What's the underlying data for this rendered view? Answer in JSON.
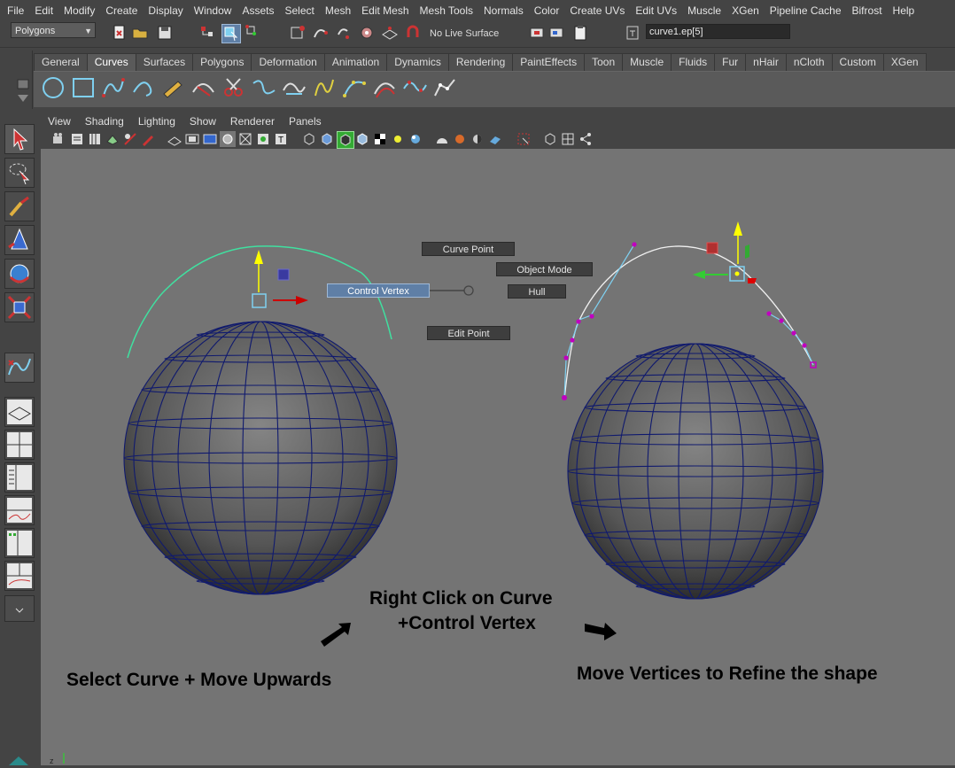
{
  "menubar": [
    "File",
    "Edit",
    "Modify",
    "Create",
    "Display",
    "Window",
    "Assets",
    "Select",
    "Mesh",
    "Edit Mesh",
    "Mesh Tools",
    "Normals",
    "Color",
    "Create UVs",
    "Edit UVs",
    "Muscle",
    "XGen",
    "Pipeline Cache",
    "Bifrost",
    "Help"
  ],
  "status": {
    "mode": "Polygons",
    "live_surface": "No Live Surface",
    "selection_field": "curve1.ep[5]"
  },
  "shelf": {
    "tabs": [
      "General",
      "Curves",
      "Surfaces",
      "Polygons",
      "Deformation",
      "Animation",
      "Dynamics",
      "Rendering",
      "PaintEffects",
      "Toon",
      "Muscle",
      "Fluids",
      "Fur",
      "nHair",
      "nCloth",
      "Custom",
      "XGen"
    ],
    "active_tab": "Curves"
  },
  "panel_menu": [
    "View",
    "Shading",
    "Lighting",
    "Show",
    "Renderer",
    "Panels"
  ],
  "marking_menu": {
    "curve_point": "Curve Point",
    "object_mode": "Object Mode",
    "control_vertex": "Control Vertex",
    "hull": "Hull",
    "edit_point": "Edit Point"
  },
  "captions": {
    "step1": "Select Curve + Move Upwards",
    "step2_line1": "Right Click on Curve",
    "step2_line2": "+Control Vertex",
    "step3": "Move Vertices to Refine the shape"
  },
  "colors": {
    "viewport_bg": "#747474",
    "ui_bg": "#444444",
    "curve_selected": "#40e0a0",
    "sphere_wire": "#101a6e",
    "highlight": "#5f7fa6",
    "cv_magenta": "#c000c0"
  }
}
